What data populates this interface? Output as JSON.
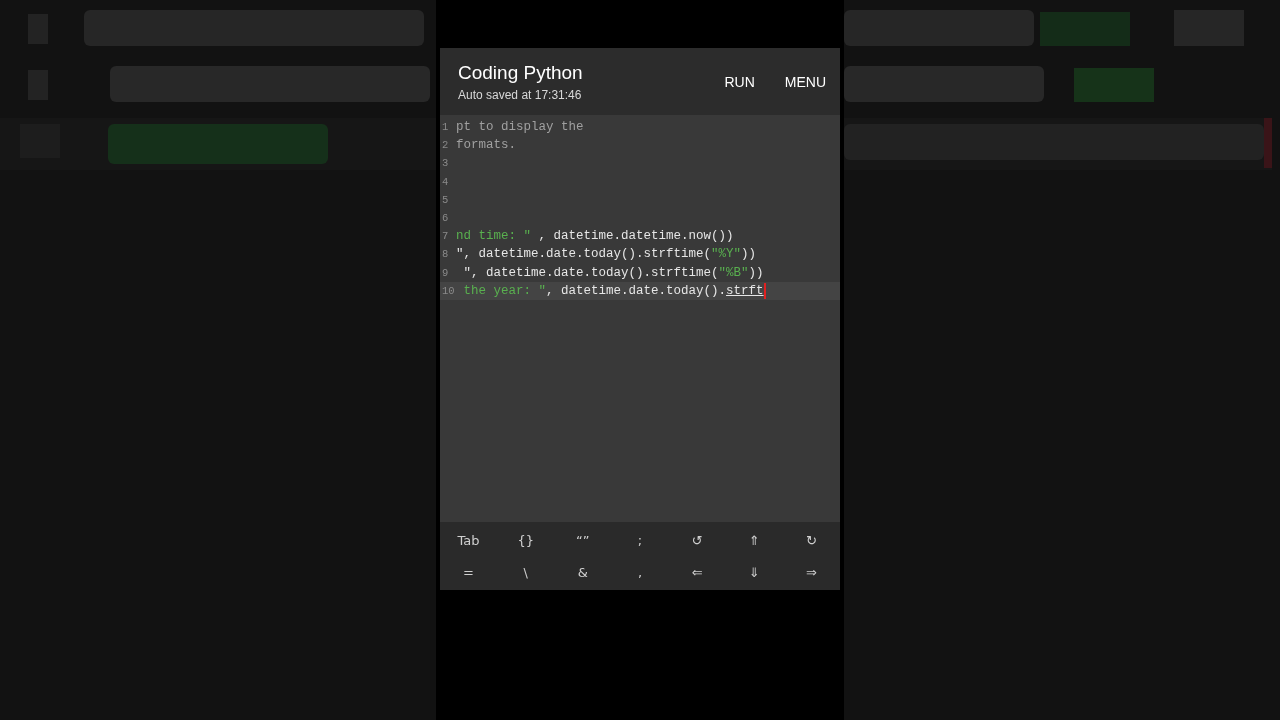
{
  "app_bar": {
    "title": "Coding Python",
    "subtitle": "Auto saved at 17:31:46",
    "actions": [
      "RUN",
      "MENU"
    ]
  },
  "editor": {
    "lines": [
      {
        "number": "1",
        "current": false,
        "cursor": false,
        "segments": [
          {
            "kind": "comment",
            "text": "pt to display the"
          }
        ]
      },
      {
        "number": "2",
        "current": false,
        "cursor": false,
        "segments": [
          {
            "kind": "comment",
            "text": "formats."
          }
        ]
      },
      {
        "number": "3",
        "current": false,
        "cursor": false
      },
      {
        "number": "4",
        "current": false,
        "cursor": false
      },
      {
        "number": "5",
        "current": false,
        "cursor": false
      },
      {
        "number": "6",
        "current": false,
        "cursor": false
      },
      {
        "number": "7",
        "current": false,
        "cursor": false,
        "segments": [
          {
            "kind": "string",
            "text": "nd time: \""
          },
          {
            "kind": "code",
            "text": " , datetime.datetime.now())"
          }
        ]
      },
      {
        "number": "8",
        "current": false,
        "cursor": false,
        "segments": [
          {
            "kind": "code",
            "text": "\", datetime.date.today().strftime("
          },
          {
            "kind": "string",
            "text": "\"%Y\""
          },
          {
            "kind": "code",
            "text": "))"
          }
        ]
      },
      {
        "number": "9",
        "current": false,
        "cursor": false,
        "segments": [
          {
            "kind": "code",
            "text": " \", datetime.date.today().strftime("
          },
          {
            "kind": "string",
            "text": "\"%B\""
          },
          {
            "kind": "code",
            "text": "))"
          }
        ]
      },
      {
        "number": "10",
        "current": true,
        "cursor": true,
        "segments": [
          {
            "kind": "string",
            "text": " the year: \""
          },
          {
            "kind": "code",
            "text": ", datetime.date.today()."
          },
          {
            "kind": "underlined",
            "text": "strft"
          }
        ]
      }
    ]
  },
  "keys": [
    [
      "Tab",
      "{}",
      "“”",
      ";",
      "↺",
      "⇑",
      "↻"
    ],
    [
      "=",
      "\\",
      "&",
      ",",
      "⇐",
      "⇓",
      "⇒"
    ]
  ]
}
